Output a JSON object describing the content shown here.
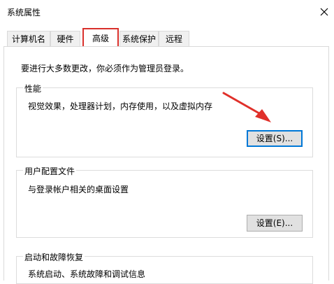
{
  "window": {
    "title": "系统属性"
  },
  "tabs": [
    {
      "label": "计算机名"
    },
    {
      "label": "硬件"
    },
    {
      "label": "高级"
    },
    {
      "label": "系统保护"
    },
    {
      "label": "远程"
    }
  ],
  "advanced": {
    "admin_note": "要进行大多数更改，你必须作为管理员登录。",
    "performance": {
      "title": "性能",
      "description": "视觉效果，处理器计划，内存使用，以及虚拟内存",
      "button_label": "设置(S)..."
    },
    "user_profiles": {
      "title": "用户配置文件",
      "description": "与登录帐户相关的桌面设置",
      "button_label": "设置(E)..."
    },
    "startup_recovery": {
      "title": "启动和故障恢复",
      "description": "系统启动、系统故障和调试信息"
    }
  },
  "colors": {
    "tab_highlight": "#d9302b",
    "arrow": "#e0302a",
    "focus": "#0078d7"
  }
}
